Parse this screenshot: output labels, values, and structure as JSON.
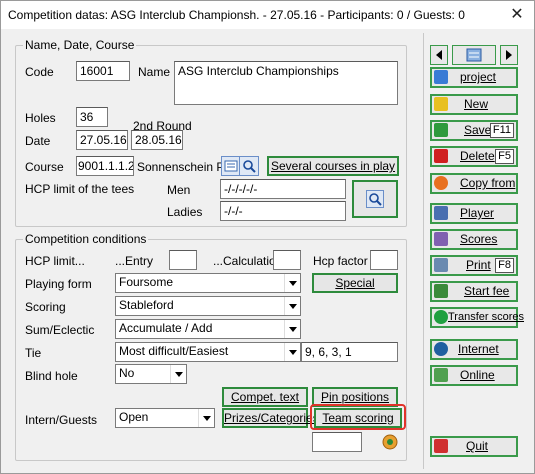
{
  "window": {
    "title": "Competition datas: ASG Interclub Championsh. - 27.05.16 - Participants: 0 / Guests: 0",
    "close": "✕"
  },
  "g1": {
    "title": "Name, Date, Course",
    "code_label": "Code",
    "code": "16001",
    "name_label": "Name",
    "name": "ASG Interclub Championships",
    "holes_label": "Holes",
    "holes": "36",
    "round2_label": "2nd Round",
    "date_label": "Date",
    "date": "27.05.16",
    "date2": "28.05.16",
    "course_label": "Course",
    "course": "9001.1.1.2",
    "course_name": "Sonnenschein Pla",
    "several": "Several courses in play",
    "hcp_tees": "HCP limit of the tees",
    "men_label": "Men",
    "men": "-/-/-/-/-",
    "ladies_label": "Ladies",
    "ladies": "-/-/-"
  },
  "g2": {
    "title": "Competition conditions",
    "hcp_limit": "HCP limit...",
    "entry": "...Entry",
    "calc": "...Calculation",
    "hcp_factor": "Hcp factor",
    "pf_label": "Playing form",
    "pf": "Foursome",
    "special": "Special",
    "scoring_label": "Scoring",
    "scoring": "Stableford",
    "sum_label": "Sum/Eclectic",
    "sum": "Accumulate / Add",
    "tie_label": "Tie",
    "tie": "Most difficult/Easiest",
    "tie_val": "9, 6, 3, 1",
    "blind_label": "Blind hole",
    "blind": "No",
    "compet_text": "Compet. text",
    "pin": "Pin positions",
    "intern_label": "Intern/Guests",
    "intern": "Open",
    "prizes": "Prizes/Categories",
    "team": "Team scoring"
  },
  "side": [
    {
      "label": "project",
      "color": "#3a7bd5",
      "icon": "project-icon"
    },
    {
      "label": "New",
      "color": "#e8c020",
      "icon": "new-icon"
    },
    {
      "label": "Save",
      "key": "F11",
      "color": "#2e9a3c",
      "icon": "check-icon"
    },
    {
      "label": "Delete",
      "key": "F5",
      "color": "#d02020",
      "icon": "delete-icon"
    },
    {
      "label": "Copy from",
      "color": "#e87020",
      "icon": "copy-icon"
    },
    {
      "label": "Player",
      "color": "#4a6fb0",
      "icon": "player-icon"
    },
    {
      "label": "Scores",
      "color": "#8060b0",
      "icon": "scores-icon"
    },
    {
      "label": "Print",
      "key": "F8",
      "color": "#6a8ab0",
      "icon": "printer-icon"
    },
    {
      "label": "Start fee",
      "color": "#3a8a3a",
      "icon": "start-fee-icon"
    },
    {
      "label": "Transfer scores",
      "color": "#20a040",
      "icon": "transfer-icon"
    },
    {
      "label": "Internet",
      "color": "#2060a0",
      "icon": "internet-icon"
    },
    {
      "label": "Online",
      "color": "#50a050",
      "icon": "online-icon"
    },
    {
      "label": "Quit",
      "color": "#d03030",
      "icon": "quit-icon"
    }
  ]
}
